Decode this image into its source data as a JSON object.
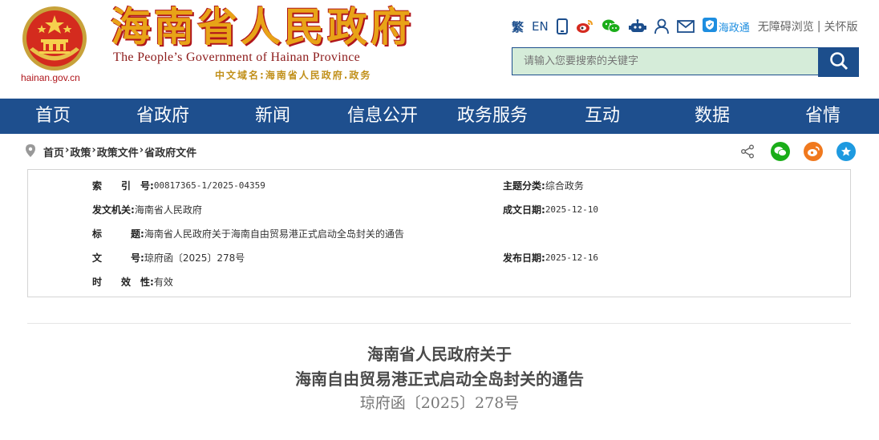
{
  "header": {
    "site_title": "海南省人民政府",
    "subtitle_en": "The People’s Government  of Hainan Province",
    "subtitle_cn": "中文域名:海南省人民政府.政务",
    "domain": "hainan.gov.cn"
  },
  "topbar": {
    "traditional": "繁",
    "english": "EN",
    "haizhengtong": "海政通",
    "accessibility": "无障碍浏览",
    "separator": "|",
    "elder_mode": "关怀版"
  },
  "search": {
    "placeholder": "请输入您要搜索的关键字"
  },
  "nav": [
    {
      "label": "首页"
    },
    {
      "label": "省政府"
    },
    {
      "label": "新闻"
    },
    {
      "label": "信息公开"
    },
    {
      "label": "政务服务"
    },
    {
      "label": "互动"
    },
    {
      "label": "数据"
    },
    {
      "label": "省情"
    }
  ],
  "breadcrumb": [
    {
      "label": "首页"
    },
    {
      "label": "政策"
    },
    {
      "label": "政策文件"
    },
    {
      "label": "省政府文件"
    }
  ],
  "breadcrumb_sep": "›",
  "info": {
    "index_label": "索　　引　号:",
    "index_value": "00817365-1/2025-04359",
    "topic_label": "主题分类:",
    "topic_value": "综合政务",
    "issuer_label": "发文机关:",
    "issuer_value": "海南省人民政府",
    "created_label": "成文日期:",
    "created_value": "2025-12-10",
    "title_label": "标　　　题:",
    "title_value": "海南省人民政府关于海南自由贸易港正式启动全岛封关的通告",
    "docno_label": "文　　　号:",
    "docno_value": "琼府函〔2025〕278号",
    "published_label": "发布日期:",
    "published_value": "2025-12-16",
    "validity_label": "时　　效　性:",
    "validity_value": "有效"
  },
  "document": {
    "title_line1": "海南省人民政府关于",
    "title_line2": "海南自由贸易港正式启动全岛封关的通告",
    "number": "琼府函〔2025〕278号"
  },
  "colors": {
    "nav_blue": "#1e4f8e",
    "title_gold": "#e8a317",
    "title_red": "#b0161c",
    "search_bg": "#d5ecd9",
    "wechat_green": "#1aad19",
    "weibo_orange": "#f0791e",
    "favorite_blue": "#1e9ae0"
  },
  "icons": [
    "national-emblem-icon",
    "phone-icon",
    "weibo-icon",
    "wechat-icon",
    "robot-icon",
    "user-icon",
    "mail-icon",
    "shield-icon",
    "search-icon",
    "location-icon",
    "share-icon",
    "wechat-share-icon",
    "weibo-share-icon",
    "favorite-icon"
  ]
}
